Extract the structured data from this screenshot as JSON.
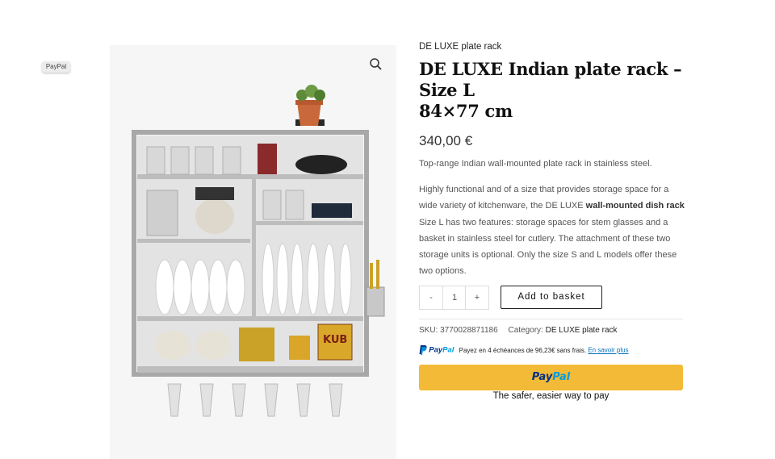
{
  "floating_tag": {
    "label": "PayPal"
  },
  "gallery": {
    "pot_label": "KUB",
    "zoom_icon": "search-icon"
  },
  "product": {
    "category": "DE LUXE plate rack",
    "title_lines": [
      "DE LUXE Indian plate rack –",
      "Size L",
      "84×77 cm"
    ],
    "price": "340,00 €",
    "short_description": "Top-range Indian wall-mounted plate rack in stainless steel.",
    "description": {
      "part1": "Highly functional and of a size that provides storage space for a wide variety of kitchenware, the DE LUXE ",
      "strong": "wall-mounted dish rack",
      "part2": " Size L has two features: storage spaces for stem glasses and a basket in stainless steel for cutlery. The attachment of these two storage units is optional. Only the size S and L models offer these two options."
    }
  },
  "cart": {
    "minus": "-",
    "quantity": "1",
    "plus": "+",
    "add_label": "Add to basket"
  },
  "meta": {
    "sku_label": "SKU:",
    "sku": "3770028871186",
    "category_label": "Category:",
    "category": "DE LUXE plate rack"
  },
  "paypal": {
    "brand_pay": "Pay",
    "brand_pal": "Pal",
    "installment_text": "Payez en 4 échéances de 96,23€ sans frais.",
    "link": "En savoir plus",
    "tagline": "The safer, easier way to pay",
    "colors": {
      "button": "#f2ba36",
      "dark_blue": "#003087",
      "light_blue": "#009cde"
    }
  }
}
